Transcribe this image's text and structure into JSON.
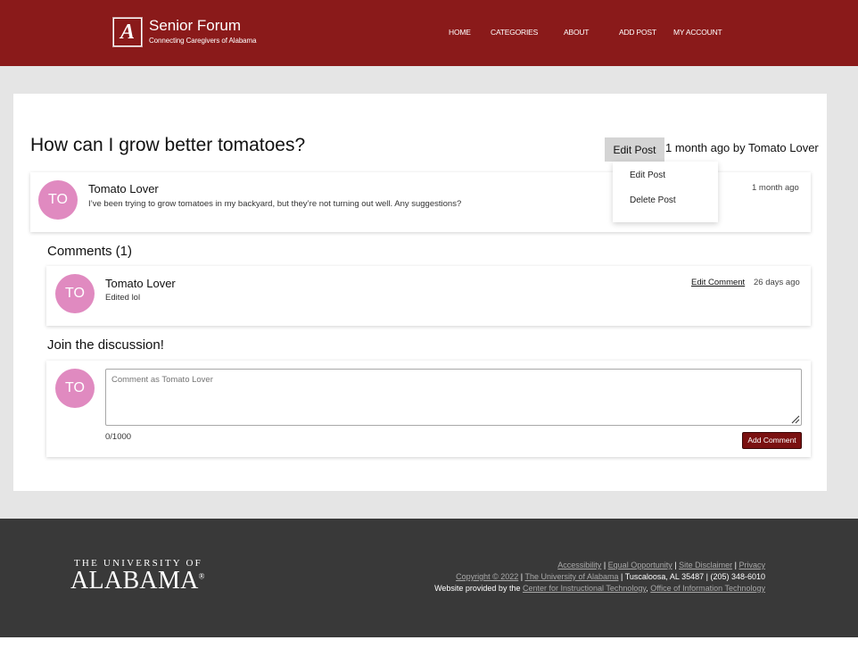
{
  "header": {
    "logo_letter": "A",
    "title": "Senior Forum",
    "tagline": "Connecting Caregivers of Alabama",
    "nav": [
      "HOME",
      "CATEGORIES",
      "ABOUT",
      "ADD POST",
      "MY ACCOUNT"
    ]
  },
  "post": {
    "title": "How can I grow better tomatoes?",
    "edit_button": "Edit Post",
    "meta": "1 month ago by Tomato Lover",
    "avatar": "TO",
    "author": "Tomato Lover",
    "body": "I’ve been trying to grow tomatoes in my backyard, but they’re not turning out well. Any suggestions?",
    "time": "1 month ago"
  },
  "dropdown": {
    "items": [
      "Edit Post",
      "Delete Post"
    ]
  },
  "comments": {
    "heading": "Comments (1)",
    "items": [
      {
        "avatar": "TO",
        "author": "Tomato Lover",
        "text": "Edited lol",
        "edit_label": "Edit Comment",
        "time": "26 days ago"
      }
    ]
  },
  "discussion": {
    "heading": "Join the discussion!",
    "avatar": "TO",
    "placeholder": "Comment as Tomato Lover",
    "counter": "0/1000",
    "submit": "Add Comment"
  },
  "footer": {
    "brand_top": "THE UNIVERSITY OF",
    "brand_main": "ALABAMA",
    "brand_reg": "®",
    "links_row1": [
      "Accessibility",
      "Equal Opportunity",
      "Site Disclaimer",
      "Privacy"
    ],
    "copyright": "Copyright © 2022",
    "university_link": "The University of Alabama",
    "address": "Tuscaloosa, AL 35487 | (205) 348-6010",
    "provided_by": "Website provided by the",
    "cit_link": "Center for Instructional Technology",
    "oit_link": "Office of Information Technology",
    "separator": "|",
    "comma": ","
  },
  "colors": {
    "brand": "#8a1a1a",
    "avatar": "#e08ac0",
    "footer": "#393939",
    "button": "#7a1111"
  }
}
